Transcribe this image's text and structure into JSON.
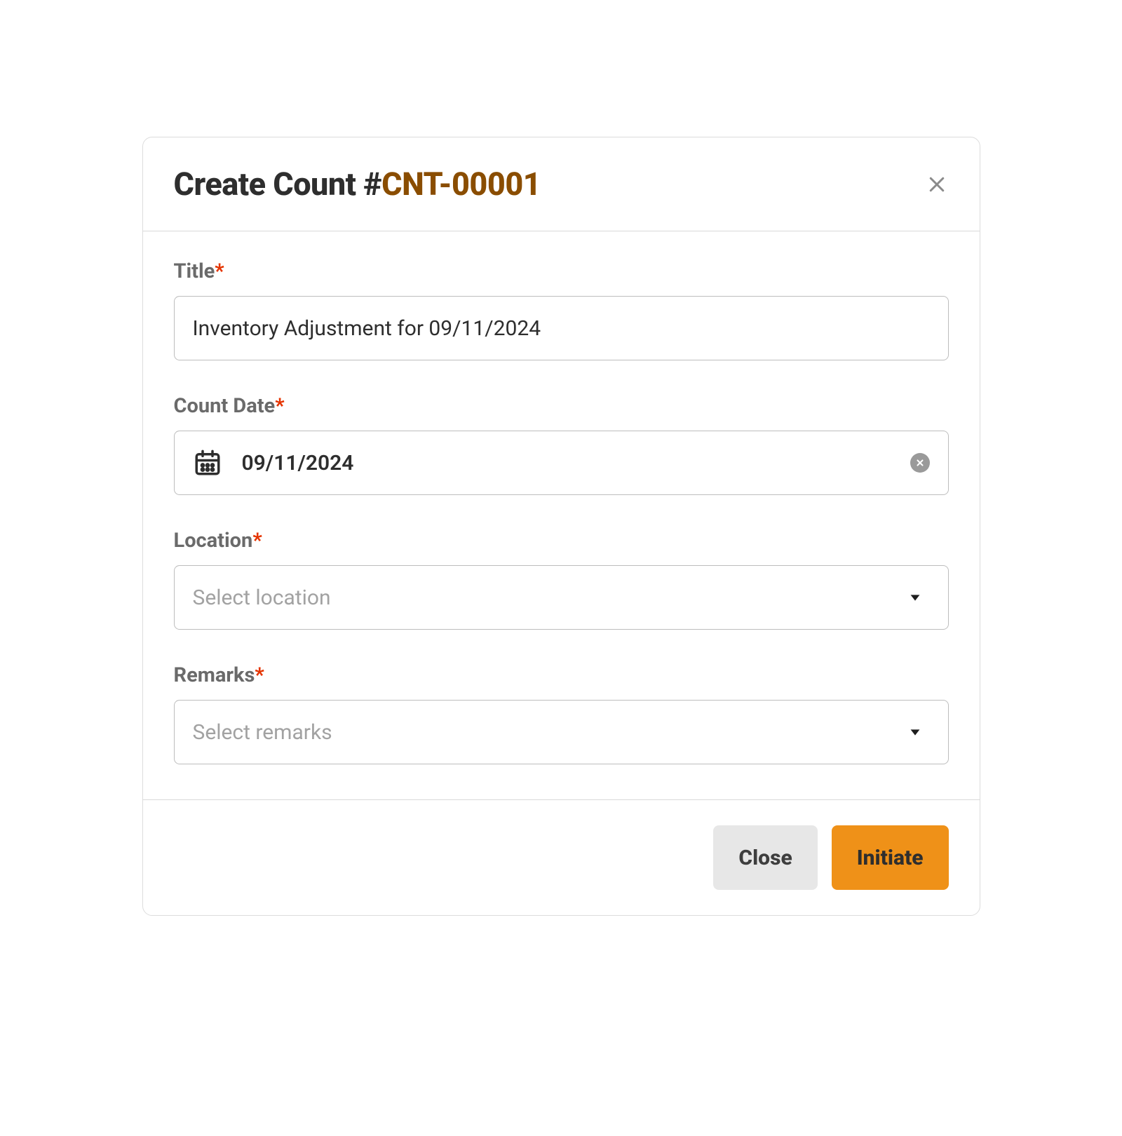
{
  "modal": {
    "title_prefix": "Create Count #",
    "title_id": "CNT-00001",
    "fields": {
      "title": {
        "label": "Title",
        "value": "Inventory Adjustment for 09/11/2024"
      },
      "count_date": {
        "label": "Count Date",
        "value": "09/11/2024"
      },
      "location": {
        "label": "Location",
        "placeholder": "Select location"
      },
      "remarks": {
        "label": "Remarks",
        "placeholder": "Select remarks"
      }
    },
    "buttons": {
      "close": "Close",
      "initiate": "Initiate"
    }
  }
}
